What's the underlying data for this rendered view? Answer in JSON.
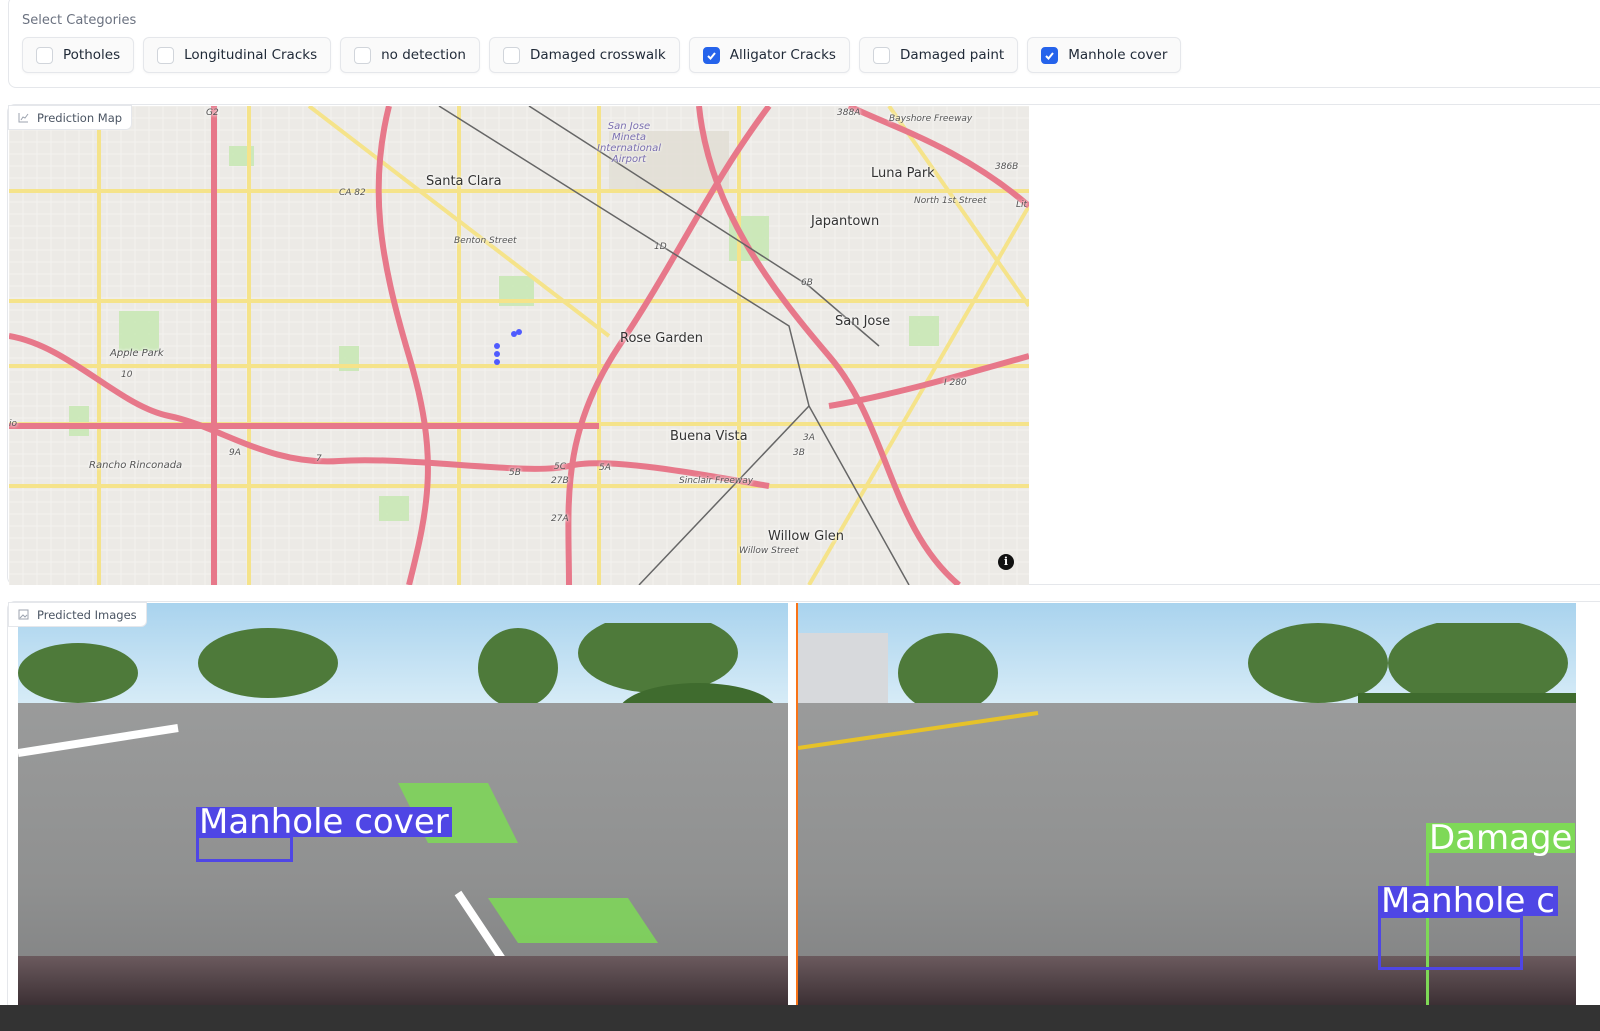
{
  "categories": {
    "title": "Select Categories",
    "options": [
      {
        "label": "Potholes",
        "checked": false
      },
      {
        "label": "Longitudinal Cracks",
        "checked": false
      },
      {
        "label": "no detection",
        "checked": false
      },
      {
        "label": "Damaged crosswalk",
        "checked": false
      },
      {
        "label": "Alligator Cracks",
        "checked": true
      },
      {
        "label": "Damaged paint",
        "checked": false
      },
      {
        "label": "Manhole cover",
        "checked": true
      }
    ],
    "accent": "#2563eb"
  },
  "map": {
    "label": "Prediction Map",
    "icon": "chart-icon",
    "place_labels": [
      "Santa Clara",
      "Luna Park",
      "Japantown",
      "San Jose",
      "Rose Garden",
      "Buena Vista",
      "Willow Glen",
      "Apple Park",
      "Rancho Rinconada",
      "San Jose Mineta International Airport"
    ],
    "road_labels": [
      "G2",
      "CA 82",
      "I 280",
      "Benton Street",
      "Bayshore Freeway",
      "Sinclair Freeway",
      "Willow Street",
      "North 1st Street",
      "7",
      "5B",
      "5C",
      "5A",
      "27B",
      "27A",
      "1D",
      "10",
      "9A",
      "6B",
      "3A",
      "3B",
      "386B",
      "388A",
      "Lit",
      "io"
    ],
    "marker_color": "#4f5bff",
    "info_icon": "info-icon"
  },
  "images": {
    "label": "Predicted Images",
    "icon": "image-icon",
    "items": [
      {
        "detections": [
          {
            "label": "Manhole cover",
            "color": "#4f46e5"
          }
        ]
      },
      {
        "detections": [
          {
            "label": "Damage",
            "color": "#7ed957"
          },
          {
            "label": "Manhole c",
            "color": "#4f46e5"
          }
        ]
      }
    ]
  }
}
